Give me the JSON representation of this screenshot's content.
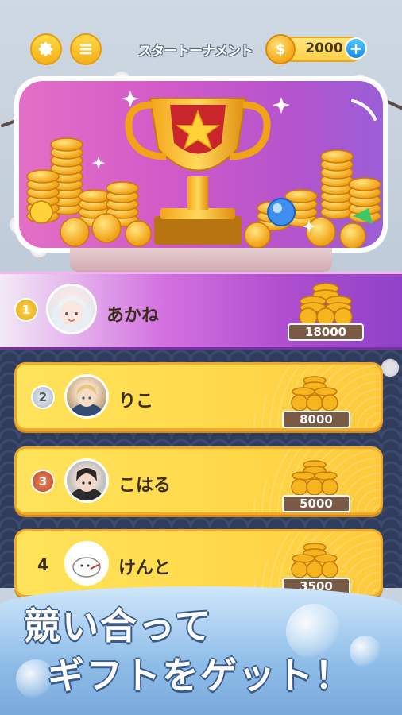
{
  "header": {
    "settings_icon": "gear-icon",
    "menu_icon": "menu-icon",
    "tournament_label": "スタートーナメント",
    "coin_balance": "2000",
    "coin_symbol": "$",
    "add_icon": "+"
  },
  "leaderboard": [
    {
      "rank": "1",
      "name": "あかね",
      "score": "18000"
    },
    {
      "rank": "2",
      "name": "りこ",
      "score": "8000"
    },
    {
      "rank": "3",
      "name": "こはる",
      "score": "5000"
    },
    {
      "rank": "4",
      "name": "けんと",
      "score": "3500"
    }
  ],
  "caption": {
    "line1": "競い合って",
    "line2": "ギフトをゲット！"
  },
  "colors": {
    "gold": "#f5a815",
    "purple": "#b04ecf",
    "row_yellow": "#ffd84a",
    "navy": "#2f3c5c"
  }
}
